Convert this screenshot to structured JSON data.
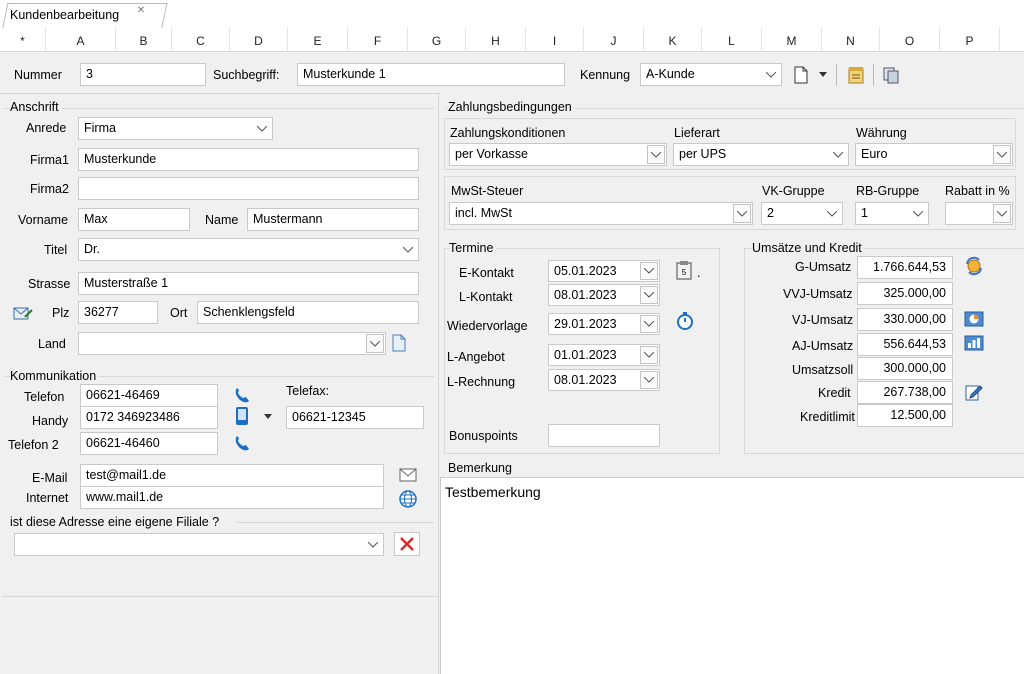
{
  "tab": {
    "title": "Kundenbearbeitung"
  },
  "columns": [
    "*",
    "A",
    "B",
    "C",
    "D",
    "E",
    "F",
    "G",
    "H",
    "I",
    "J",
    "K",
    "L",
    "M",
    "N",
    "O",
    "P"
  ],
  "header": {
    "nummer_label": "Nummer",
    "nummer_value": "3",
    "suchbegriff_label": "Suchbegriff:",
    "suchbegriff_value": "Musterkunde 1",
    "kennung_label": "Kennung",
    "kennung_value": "A-Kunde"
  },
  "anschrift": {
    "title": "Anschrift",
    "anrede_label": "Anrede",
    "anrede_value": "Firma",
    "firma1_label": "Firma1",
    "firma1_value": "Musterkunde",
    "firma2_label": "Firma2",
    "firma2_value": "",
    "vorname_label": "Vorname",
    "vorname_value": "Max",
    "name_label": "Name",
    "name_value": "Mustermann",
    "titel_label": "Titel",
    "titel_value": "Dr.",
    "strasse_label": "Strasse",
    "strasse_value": "Musterstraße 1",
    "plz_label": "Plz",
    "plz_value": "36277",
    "ort_label": "Ort",
    "ort_value": "Schenklengsfeld",
    "land_label": "Land",
    "land_value": ""
  },
  "kommunikation": {
    "title": "Kommunikation",
    "telefon_label": "Telefon",
    "telefon_value": "06621-46469",
    "handy_label": "Handy",
    "handy_value": "0172 346923486",
    "telefon2_label": "Telefon 2",
    "telefon2_value": "06621-46460",
    "telefax_label": "Telefax:",
    "telefax_value": "06621-12345",
    "email_label": "E-Mail",
    "email_value": "test@mail1.de",
    "internet_label": "Internet",
    "internet_value": "www.mail1.de",
    "filiale_question": "ist diese Adresse eine eigene Filiale ?",
    "filiale_value": ""
  },
  "zahlung": {
    "title": "Zahlungsbedingungen",
    "konditionen_label": "Zahlungskonditionen",
    "konditionen_value": "per Vorkasse",
    "lieferart_label": "Lieferart",
    "lieferart_value": "per UPS",
    "waehrung_label": "Währung",
    "waehrung_value": "Euro",
    "mwst_label": "MwSt-Steuer",
    "mwst_value": "incl. MwSt",
    "vk_label": "VK-Gruppe",
    "vk_value": "2",
    "rb_label": "RB-Gruppe",
    "rb_value": "1",
    "rabatt_label": "Rabatt in %",
    "rabatt_value": ""
  },
  "termine": {
    "title": "Termine",
    "ekontakt_label": "E-Kontakt",
    "ekontakt_value": "05.01.2023",
    "lkontakt_label": "L-Kontakt",
    "lkontakt_value": "08.01.2023",
    "wiedervorlage_label": "Wiedervorlage",
    "wiedervorlage_value": "29.01.2023",
    "langebot_label": "L-Angebot",
    "langebot_value": "01.01.2023",
    "lrechnung_label": "L-Rechnung",
    "lrechnung_value": "08.01.2023",
    "bonus_label": "Bonuspoints",
    "bonus_value": "",
    "dot": "."
  },
  "umsaetze": {
    "title": "Umsätze und Kredit",
    "g_label": "G-Umsatz",
    "g_value": "1.766.644,53",
    "vvj_label": "VVJ-Umsatz",
    "vvj_value": "325.000,00",
    "vj_label": "VJ-Umsatz",
    "vj_value": "330.000,00",
    "aj_label": "AJ-Umsatz",
    "aj_value": "556.644,53",
    "soll_label": "Umsatzsoll",
    "soll_value": "300.000,00",
    "kredit_label": "Kredit",
    "kredit_value": "267.738,00",
    "limit_label": "Kreditlimit",
    "limit_value": "12.500,00"
  },
  "bemerkung": {
    "title": "Bemerkung",
    "text": "Testbemerkung"
  },
  "colors": {
    "phone_blue": "#1e6fc4",
    "close_red": "#d92b2b",
    "border": "#c9c9c9"
  }
}
